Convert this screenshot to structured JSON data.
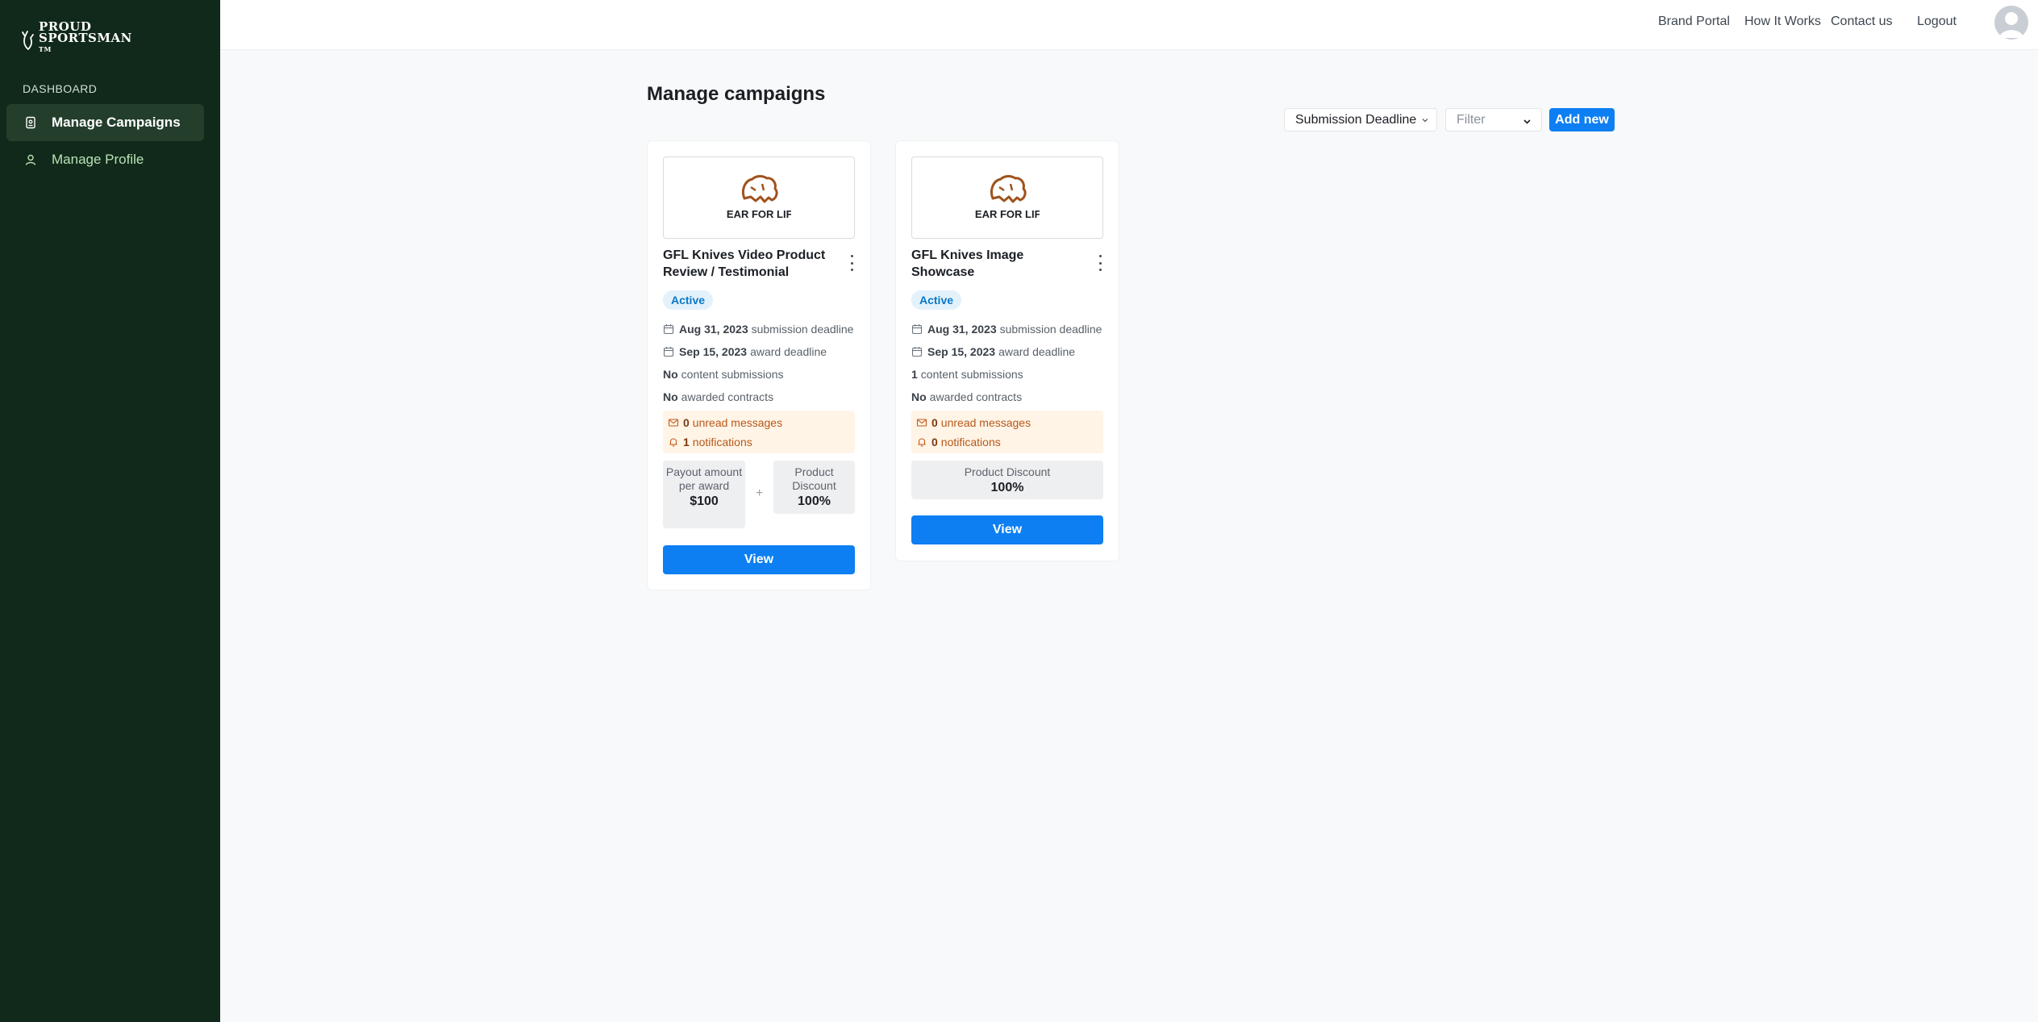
{
  "brand": {
    "logo_line1": "Proud",
    "logo_line2": "Sportsman",
    "logo_tm": "TM"
  },
  "sidebar": {
    "heading": "DASHBOARD",
    "items": [
      {
        "label": "Manage Campaigns",
        "icon": "campaign-icon",
        "active": true
      },
      {
        "label": "Manage Profile",
        "icon": "user-icon",
        "active": false
      }
    ]
  },
  "topnav": {
    "links": [
      "Brand Portal",
      "How It Works",
      "Contact us",
      "Logout"
    ]
  },
  "main": {
    "title": "Manage campaigns",
    "sort_label": "Submission Deadline",
    "filter_placeholder": "Filter",
    "add_label": "Add new"
  },
  "campaigns": [
    {
      "image_text": "GEAR FOR LIFE",
      "title": "GFL Knives Video Product Review / Testimonial",
      "status": "Active",
      "submission_date": "Aug 31, 2023",
      "submission_suffix": "submission deadline",
      "award_date": "Sep 15, 2023",
      "award_suffix": "award deadline",
      "content_count": "No",
      "content_suffix": "content submissions",
      "contracts_count": "No",
      "contracts_suffix": "awarded contracts",
      "unread_count": "0",
      "unread_suffix": "unread messages",
      "notif_count": "1",
      "notif_suffix": "notifications",
      "payout_label": "Payout amount per award",
      "payout_value": "$100",
      "plus": "+",
      "discount_label": "Product Discount",
      "discount_value": "100%",
      "view_label": "View"
    },
    {
      "image_text": "GEAR FOR LIFE",
      "title": "GFL Knives Image Showcase",
      "status": "Active",
      "submission_date": "Aug 31, 2023",
      "submission_suffix": "submission deadline",
      "award_date": "Sep 15, 2023",
      "award_suffix": "award deadline",
      "content_count": "1",
      "content_suffix": "content submissions",
      "contracts_count": "No",
      "contracts_suffix": "awarded contracts",
      "unread_count": "0",
      "unread_suffix": "unread messages",
      "notif_count": "0",
      "notif_suffix": "notifications",
      "discount_label": "Product Discount",
      "discount_value": "100%",
      "view_label": "View"
    }
  ],
  "colors": {
    "sidebar_bg": "#11291a",
    "accent": "#0d7ff2",
    "badge_bg": "#e3f1fb",
    "notice_bg": "#fff4e6",
    "logo_brown": "#a0521c"
  }
}
